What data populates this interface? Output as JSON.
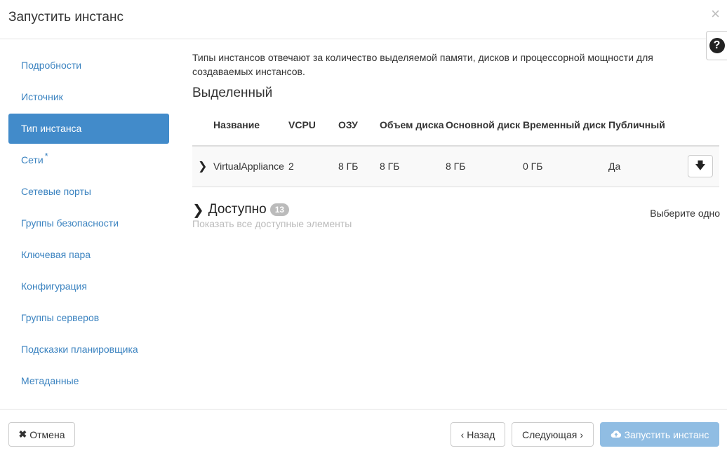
{
  "header": {
    "title": "Запустить инстанс",
    "close_icon": "×"
  },
  "help": {
    "icon": "?"
  },
  "sidebar": {
    "items": [
      {
        "label": "Подробности"
      },
      {
        "label": "Источник"
      },
      {
        "label": "Тип инстанса"
      },
      {
        "label": "Сети",
        "required": "*"
      },
      {
        "label": "Сетевые порты"
      },
      {
        "label": "Группы безопасности"
      },
      {
        "label": "Ключевая пара"
      },
      {
        "label": "Конфигурация"
      },
      {
        "label": "Группы серверов"
      },
      {
        "label": "Подсказки планировщика"
      },
      {
        "label": "Метаданные"
      }
    ],
    "active_index": 2
  },
  "main": {
    "help_text": "Типы инстансов отвечают за количество выделяемой памяти, дисков и процессорной мощности для создаваемых инстансов.",
    "allocated_title": "Выделенный",
    "columns": [
      "Название",
      "VCPU",
      "ОЗУ",
      "Объем диска",
      "Основной диск",
      "Временный диск",
      "Публичный"
    ],
    "rows": [
      {
        "name": "VirtualAppliance",
        "vcpu": "2",
        "ram": "8 ГБ",
        "disk": "8 ГБ",
        "root_disk": "8 ГБ",
        "ephemeral_disk": "0 ГБ",
        "public": "Да"
      }
    ],
    "available": {
      "title": "Доступно",
      "count": "13",
      "subtitle": "Показать все доступные элементы",
      "select_one": "Выберите одно"
    }
  },
  "footer": {
    "cancel_label": "Отмена",
    "back_label": "Назад",
    "next_label": "Следующая",
    "launch_label": "Запустить инстанс"
  }
}
